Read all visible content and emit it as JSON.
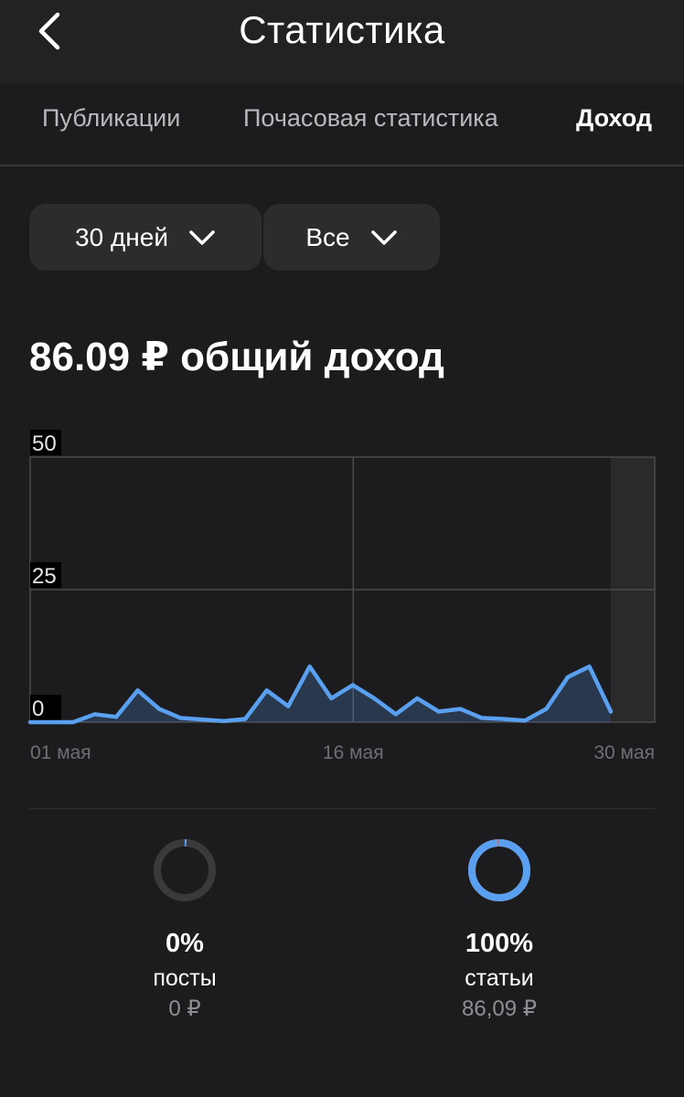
{
  "header": {
    "title": "Статистика"
  },
  "tabs": [
    {
      "label": "Публикации",
      "active": false
    },
    {
      "label": "Почасовая статистика",
      "active": false
    },
    {
      "label": "Доход",
      "active": true
    }
  ],
  "filters": {
    "period": "30 дней",
    "type": "Все"
  },
  "summary": {
    "total_text": "86.09 ₽ общий доход"
  },
  "chart_data": {
    "type": "area",
    "y_ticks": [
      0,
      25,
      50
    ],
    "ylim": [
      0,
      50
    ],
    "x_tick_labels": [
      "01 мая",
      "16 мая",
      "30 мая"
    ],
    "x_tick_days": [
      1,
      16,
      30
    ],
    "series": [
      {
        "values": [
          0,
          0,
          0,
          1.5,
          1,
          6,
          2.5,
          0.8,
          0.5,
          0.2,
          0.6,
          6,
          3,
          10.5,
          4.5,
          7,
          4.5,
          1.5,
          4.5,
          2,
          2.5,
          0.8,
          0.6,
          0.3,
          2.5,
          8.5,
          10.5,
          2
        ],
        "color": "#5aa0f0"
      }
    ]
  },
  "breakdown": [
    {
      "percent": "0%",
      "label": "посты",
      "amount": "0 ₽",
      "ring_fraction": 0.01,
      "ring_color": "#5aa0f0"
    },
    {
      "percent": "100%",
      "label": "статьи",
      "amount": "86,09 ₽",
      "ring_fraction": 0.99,
      "ring_color": "#5aa0f0",
      "accent_color": "#e8663a"
    }
  ],
  "colors": {
    "background": "#1c1c1e",
    "line": "#5aa0f0",
    "muted": "#8e8e93"
  }
}
